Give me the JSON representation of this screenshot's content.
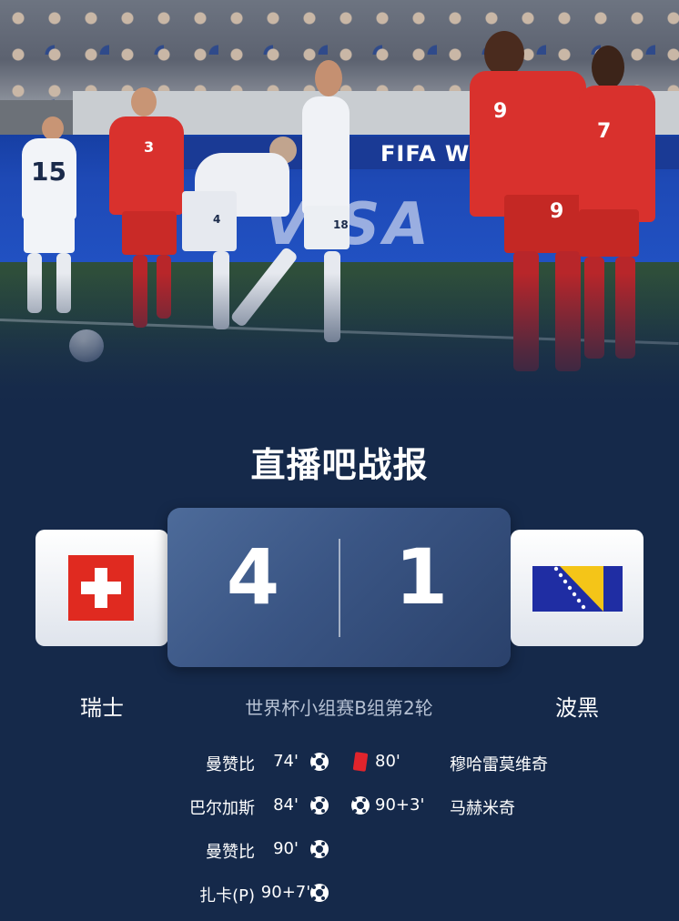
{
  "hero": {
    "board_text": "FIFA WORL",
    "sponsor_text": "VISA",
    "shirt_numbers": [
      "15",
      "3",
      "4",
      "18",
      "9",
      "7",
      "9"
    ]
  },
  "brand": {
    "title": "直播吧战报"
  },
  "match": {
    "home": {
      "name": "瑞士",
      "score": "4",
      "flag_icon": "switzerland-flag-icon"
    },
    "away": {
      "name": "波黑",
      "score": "1",
      "flag_icon": "bosnia-herzegovina-flag-icon"
    },
    "info": "世界杯小组赛B组第2轮"
  },
  "events": [
    {
      "home": {
        "player": "曼赞比",
        "minute": "74'",
        "icon": "goal-icon"
      },
      "away": {
        "player": "穆哈雷莫维奇",
        "minute": "80'",
        "icon": "red-card-icon"
      }
    },
    {
      "home": {
        "player": "巴尔加斯",
        "minute": "84'",
        "icon": "goal-icon"
      },
      "away": {
        "player": "马赫米奇",
        "minute": "90+3'",
        "icon": "goal-icon"
      }
    },
    {
      "home": {
        "player": "曼赞比",
        "minute": "90'",
        "icon": "goal-icon"
      }
    },
    {
      "home": {
        "player": "扎卡(P)",
        "minute": "90+7'",
        "icon": "goal-icon"
      }
    }
  ],
  "colors": {
    "background": "#15294a",
    "swiss_red": "#e02a20",
    "bosnia_blue": "#1f2da3",
    "bosnia_yellow": "#f4c518",
    "red_card": "#e0242c"
  }
}
